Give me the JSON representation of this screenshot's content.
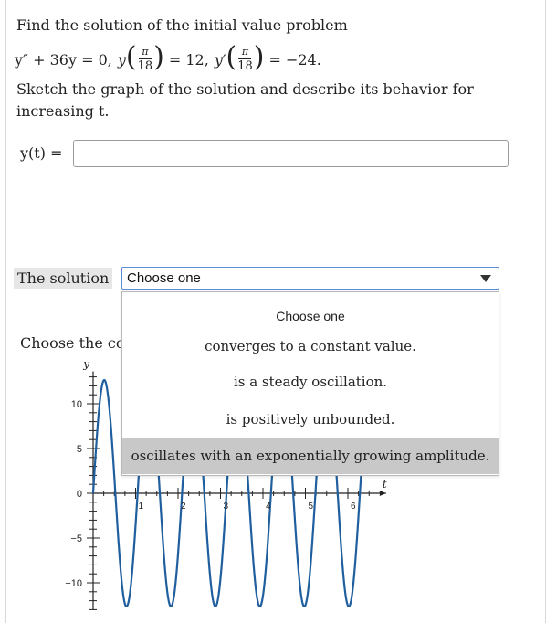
{
  "problem": {
    "line1": "Find the solution of the initial value problem",
    "eq_ode": "y″ + 36y = 0,",
    "eq_y": "y",
    "eq_frac_num": "π",
    "eq_frac_den": "18",
    "eq_val1": "= 12,",
    "eq_yp": "y′",
    "eq_val2": "= −24.",
    "line3": "Sketch the graph of the solution and describe its behavior for",
    "line4": "increasing t."
  },
  "answer": {
    "label": "y(t) =",
    "value": ""
  },
  "solution_select": {
    "label": "The solution",
    "selected": "Choose one",
    "options_header": "Choose one",
    "options": [
      "converges to a constant value.",
      "is a steady oscillation.",
      "is positively unbounded.",
      "oscillates with an exponentially growing amplitude."
    ],
    "highlighted_index": 3
  },
  "graph_section": {
    "label": "Choose the co"
  },
  "chart_data": {
    "type": "line",
    "xlabel": "t",
    "ylabel": "y",
    "xlim": [
      0,
      6.9
    ],
    "ylim": [
      -13,
      13
    ],
    "x_ticks": [
      "1",
      "2",
      "3",
      "4",
      "5",
      "6"
    ],
    "y_ticks": [
      "10",
      "5",
      "0",
      "−5",
      "−10"
    ],
    "series": [
      {
        "function": "12.65*sin(6t)",
        "amplitude": 12.65,
        "angular_frequency": 6
      }
    ],
    "line_color": "#1f5f9e"
  },
  "colors": {
    "select_border": "#5b8dd6",
    "highlight": "#c8c8c8",
    "label_bg": "#e6e6e6"
  }
}
